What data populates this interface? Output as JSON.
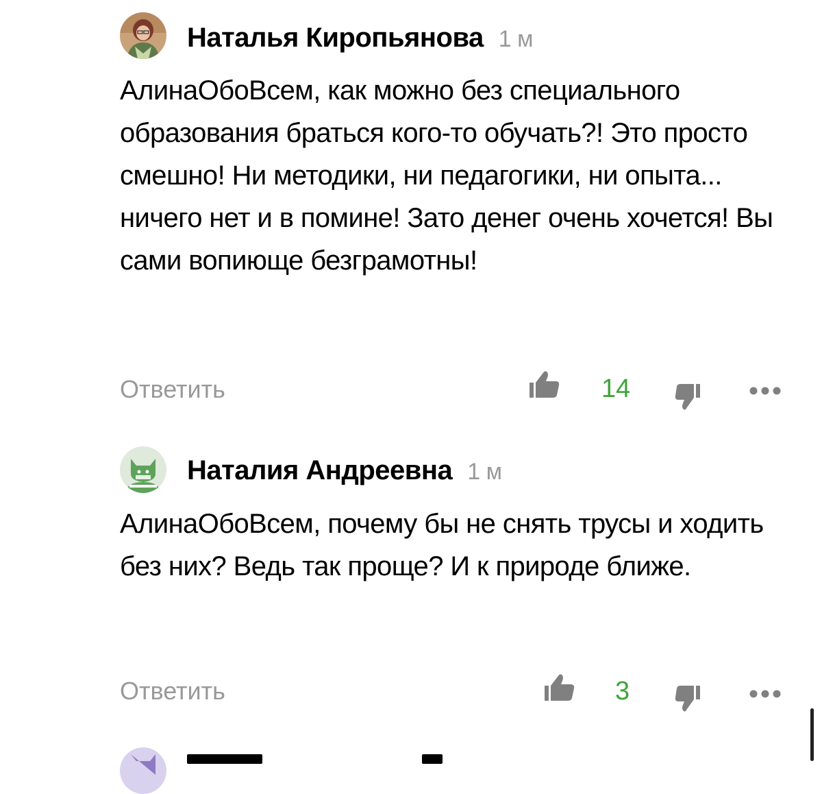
{
  "comments": [
    {
      "author": "Наталья Киропьянова",
      "time": "1 м",
      "text": "АлинаОбоВсем, как можно без специального образования браться кого-то обучать?! Это просто смешно! Ни методики, ни педагогики, ни опыта... ничего нет и в помине! Зато денег очень хочется! Вы сами вопиюще безграмотны!",
      "reply_label": "Ответить",
      "likes": "14",
      "avatar": "photo-avatar"
    },
    {
      "author": "Наталия Андреевна",
      "time": "1 м",
      "text": "АлинаОбоВсем, почему бы не снять трусы и ходить без них? Ведь так проще? И к природе ближе.",
      "reply_label": "Ответить",
      "likes": "3",
      "avatar": "cat-avatar"
    }
  ],
  "colors": {
    "likes": "#3fa43a",
    "muted": "#999999",
    "icon": "#808080",
    "avatar_bg_green": "#dfe9dc",
    "avatar_cat": "#5da35a"
  },
  "icons": {
    "like": "thumbs-up-icon",
    "dislike": "thumbs-down-icon",
    "more": "more-dots-icon"
  }
}
